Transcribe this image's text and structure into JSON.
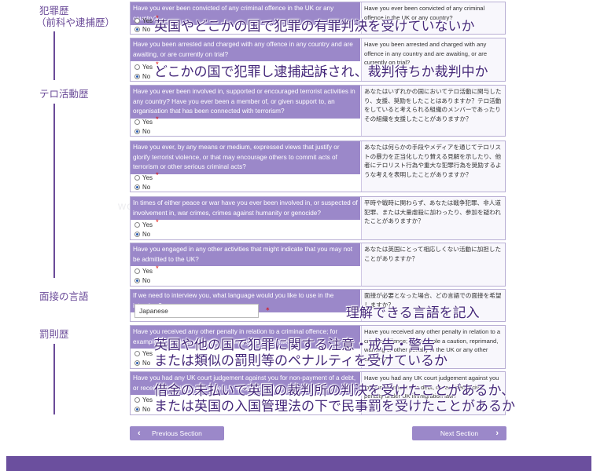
{
  "side_labels": {
    "criminal": "犯罪歴",
    "criminal_sub": "（前科や逮捕歴）",
    "terrorism": "テロ活動歴",
    "interview_lang": "面接の言語",
    "penalty": "罰則歴"
  },
  "options": {
    "yes": "Yes",
    "no": "No"
  },
  "required_mark": "*",
  "questions": [
    {
      "en": "Have you ever been convicted of any criminal offence in the UK or any country?",
      "ja": "Have you ever been convicted of any criminal offence in the UK or any country?",
      "selected": "No"
    },
    {
      "en": "Have you been arrested and charged with any offence in any country and are awaiting, or are currently on trial?",
      "ja": "Have you been arrested and charged with any offence in any country and are awaiting, or are currently on trial?",
      "selected": "No"
    },
    {
      "en": "Have you ever been involved in, supported or encouraged terrorist activities in any country? Have you ever been a member of, or given support to, an organisation that has been connected with terrorism?",
      "ja": "あなたはいずれかの国においてテロ活動に関与したり、支援、奨励をしたことはありますか？テロ活動をしていると考えられる組織のメンバーであったりその組織を支援したことがありますか？",
      "selected": "No"
    },
    {
      "en": "Have you ever, by any means or medium, expressed views that justify or glorify terrorist violence, or that may encourage others to commit acts of terrorism or other serious criminal acts?",
      "ja": "あなたは何らかの手段やメディアを通じてテロリストの暴力を正当化したり賛える見解を示したり、他者にテロリスト行為や重大な犯罪行為を奨励するような考えを表明したことがありますか？",
      "selected": "No"
    },
    {
      "en": "In times of either peace or war have you ever been involved in, or suspected of involvement in, war crimes, crimes against humanity or genocide?",
      "ja": "平時や戦時に関わらず、あなたは戦争犯罪、非人道犯罪、または大量虐殺に加わったり、参加を疑われたことがありますか？",
      "selected": "No"
    },
    {
      "en": "Have you engaged in any other activities that might indicate that you may not be admitted to the UK?",
      "ja": "あなたは英国にとって相応しくない活動に加担したことがありますか？",
      "selected": "No"
    },
    {
      "en": "If we need to interview you, what language would you like to use in the interview?",
      "ja": "面接が必要となった場合、どの言語での面接を希望しますか？",
      "value": "Japanese"
    },
    {
      "en": "Have you received any other penalty in relation to a criminal offence; for example a caution, reprimand, warning or other penalty?",
      "ja": "Have you received any other penalty in relation to a criminal offence; for example a caution, reprimand, warning or other penalty in the UK or any other country?",
      "selected": "No"
    },
    {
      "en": "Have you had any UK court judgement against you for non-payment of a debt, or received a civil penalty under UK immigration law?",
      "ja": "Have you had any UK court judgement against you for non-payment of a debt, or received a civil penalty under UK immigration law?",
      "selected": "No"
    }
  ],
  "overlays": {
    "q1": "英国やどこかの国で犯罪の有罪判決を受けていないか",
    "q2": "どこかの国で犯罪し逮捕起訴され、裁判待ちか裁判中か",
    "lang": "理解できる言語を記入",
    "penalty_1": "英国や他の国で犯罪に関する注意・戒告・警告",
    "penalty_2": "または類似の罰則等のペナルティを受けているか",
    "court_1": "借金の未払いで英国の裁判所の判決を受けたことがあるか、",
    "court_2": "または英国の入国管理法の下で民事罰を受けたことがあるか"
  },
  "nav": {
    "previous": "Previous Section",
    "next": "Next Section"
  },
  "icons": {
    "prev": "chevron-left-icon",
    "next": "chevron-right-icon"
  },
  "colors": {
    "accent": "#9b88c9",
    "annotation": "#6a4a98",
    "footer": "#6b4f9e",
    "required": "#dd0000"
  }
}
